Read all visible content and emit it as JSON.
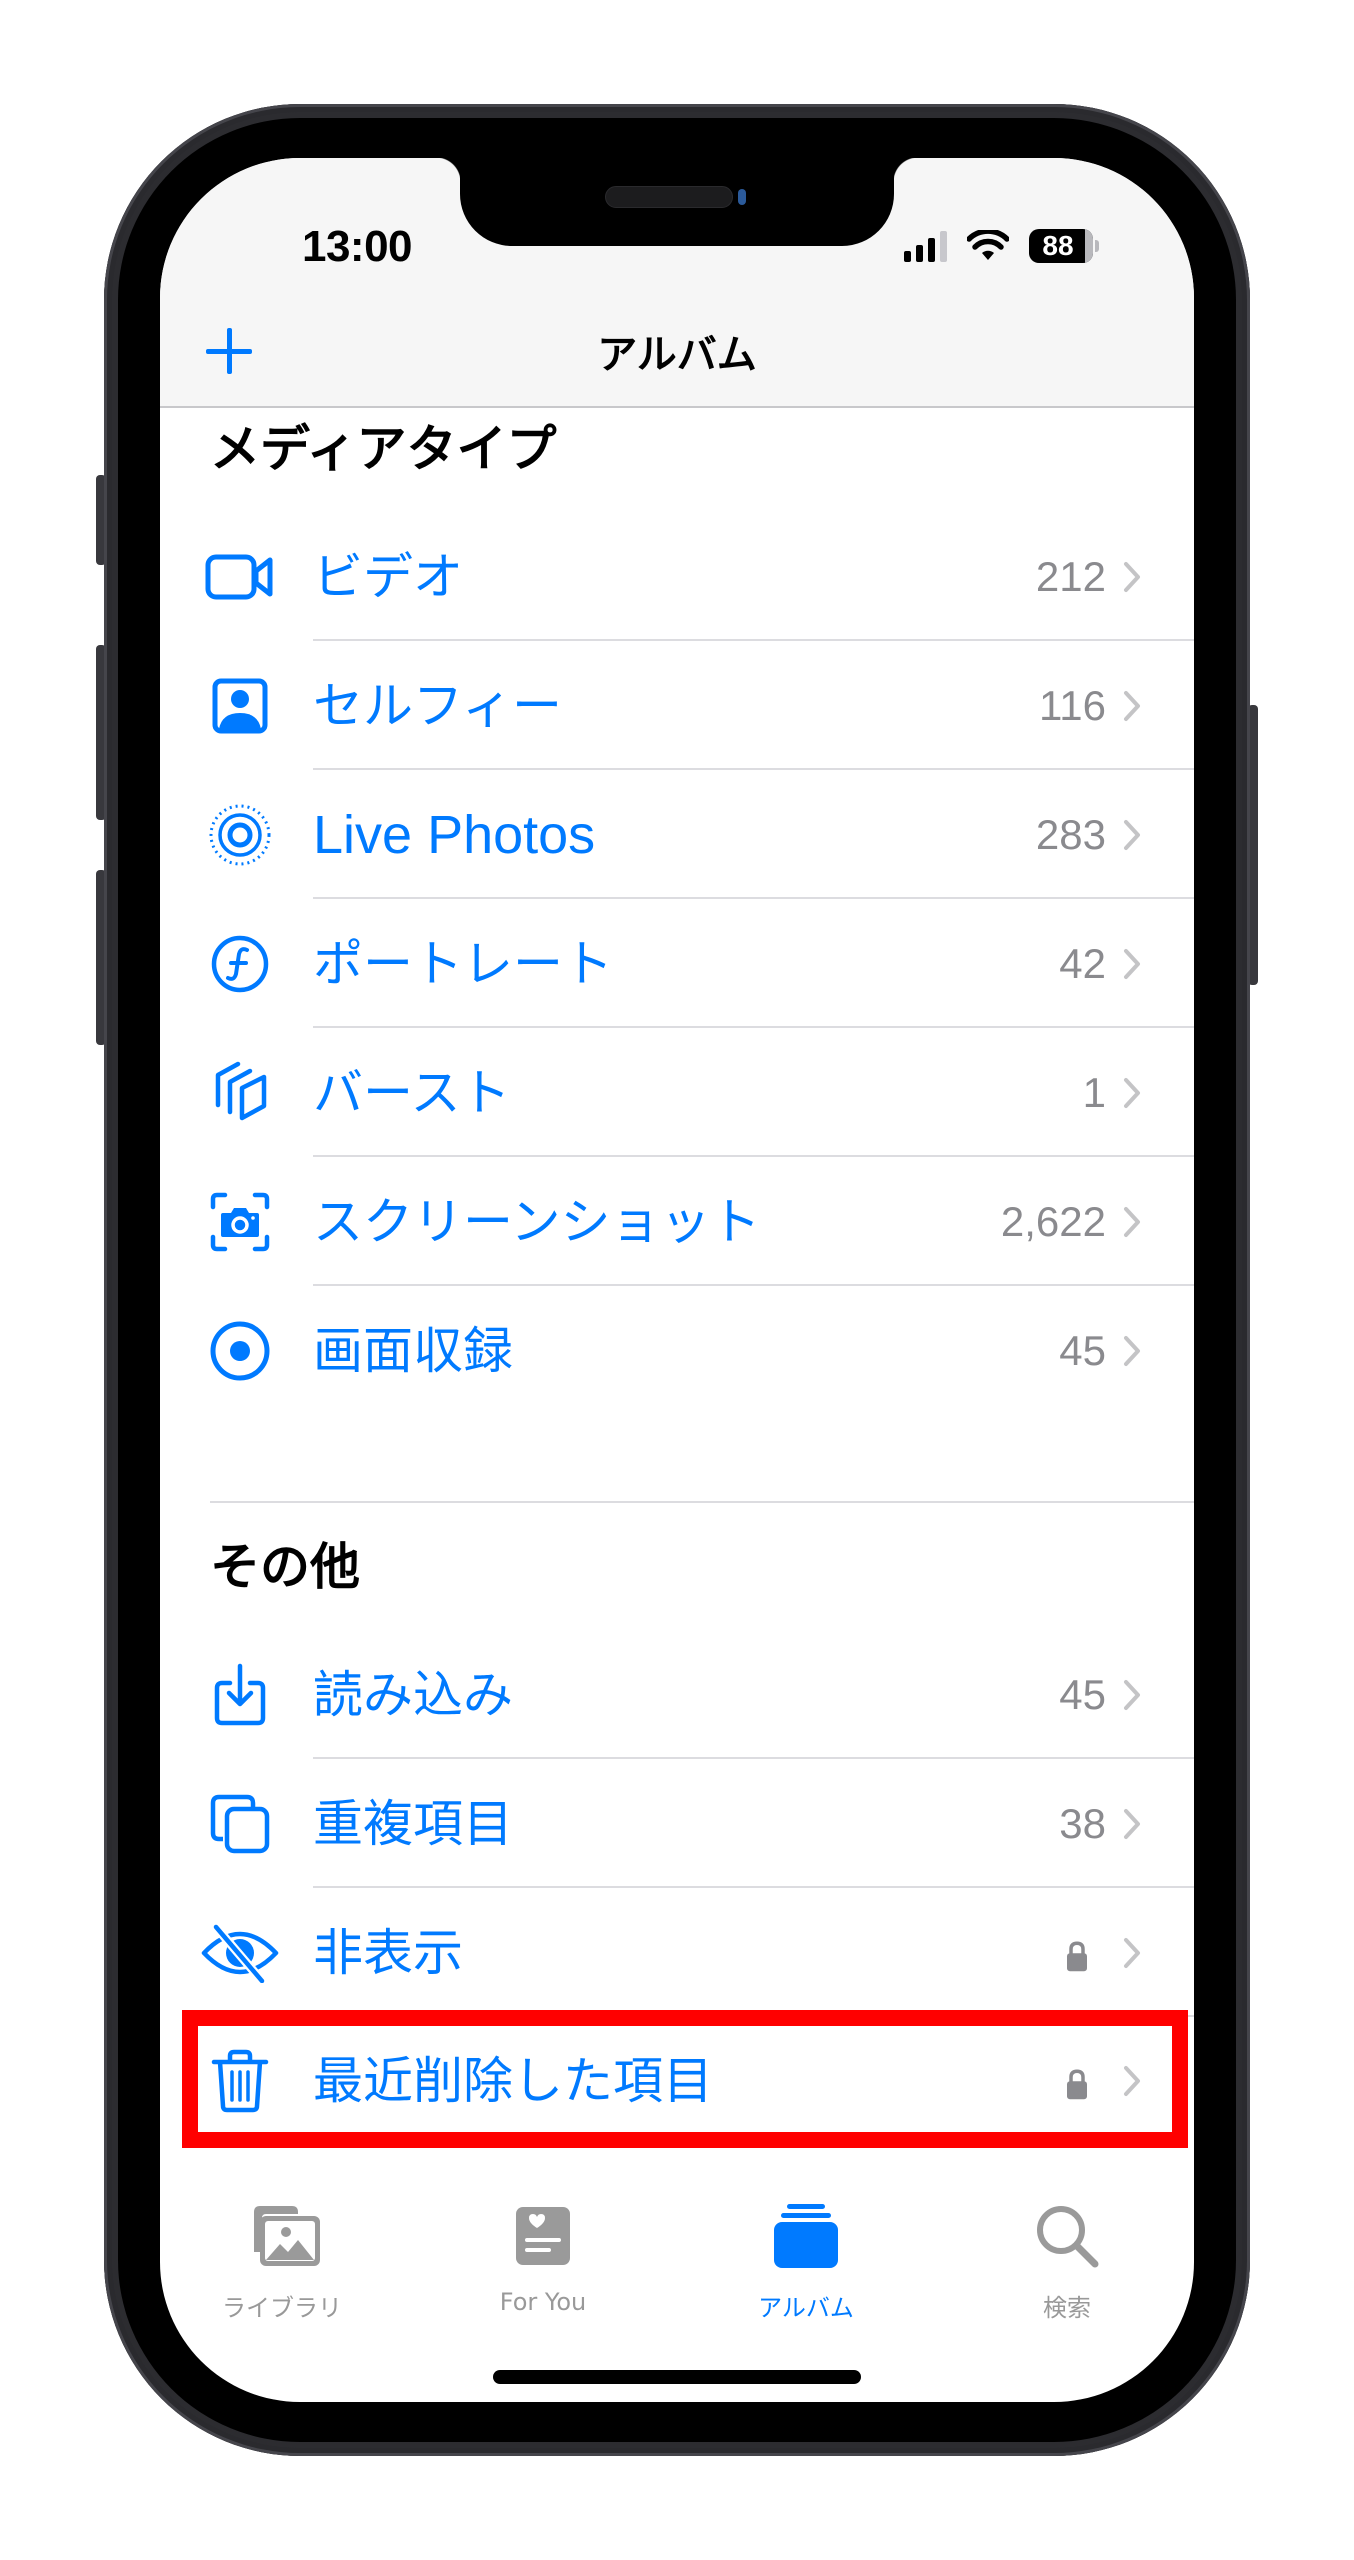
{
  "status_bar": {
    "time": "13:00",
    "signal_bars_active": 3,
    "signal_bars_total": 4,
    "battery_level": "88"
  },
  "nav": {
    "title": "アルバム",
    "add_button": "+"
  },
  "sections": [
    {
      "title": "メディアタイプ",
      "items": [
        {
          "icon": "video-icon",
          "label": "ビデオ",
          "count": "212"
        },
        {
          "icon": "selfie-icon",
          "label": "セルフィー",
          "count": "116"
        },
        {
          "icon": "live-photos-icon",
          "label": "Live Photos",
          "count": "283"
        },
        {
          "icon": "portrait-icon",
          "label": "ポートレート",
          "count": "42"
        },
        {
          "icon": "burst-icon",
          "label": "バースト",
          "count": "1"
        },
        {
          "icon": "screenshot-icon",
          "label": "スクリーンショット",
          "count": "2,622"
        },
        {
          "icon": "screen-recording-icon",
          "label": "画面収録",
          "count": "45"
        }
      ]
    },
    {
      "title": "その他",
      "items": [
        {
          "icon": "import-icon",
          "label": "読み込み",
          "count": "45"
        },
        {
          "icon": "duplicate-icon",
          "label": "重複項目",
          "count": "38"
        },
        {
          "icon": "hidden-icon",
          "label": "非表示",
          "locked": true
        },
        {
          "icon": "trash-icon",
          "label": "最近削除した項目",
          "locked": true,
          "highlighted": true
        }
      ]
    }
  ],
  "tab_bar": {
    "tabs": [
      {
        "icon": "library-icon",
        "label": "ライブラリ",
        "active": false
      },
      {
        "icon": "for-you-icon",
        "label": "For You",
        "active": false
      },
      {
        "icon": "albums-icon",
        "label": "アルバム",
        "active": true
      },
      {
        "icon": "search-icon",
        "label": "検索",
        "active": false
      }
    ]
  },
  "colors": {
    "accent": "#007AFF",
    "count_text": "#8A8A8E",
    "chevron": "#C4C4C6",
    "tab_inactive": "#999999",
    "highlight": "#FF0000"
  }
}
